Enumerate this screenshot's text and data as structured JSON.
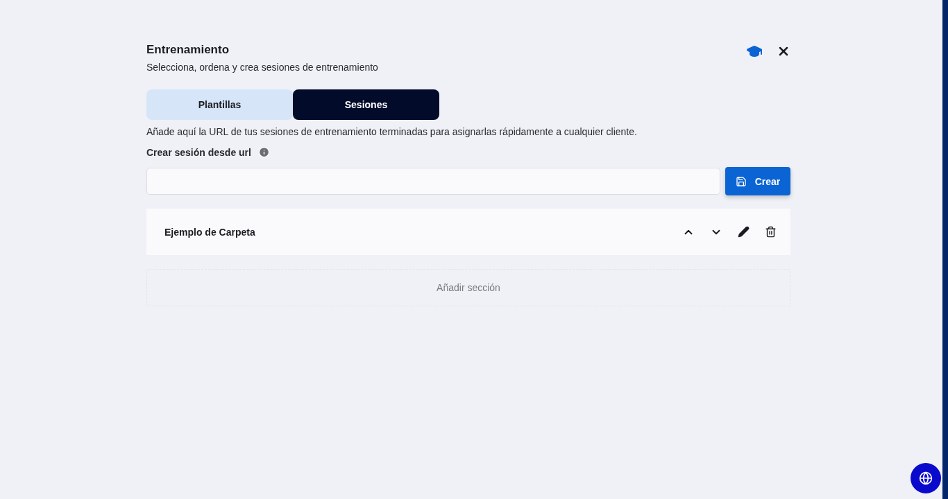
{
  "header": {
    "title": "Entrenamiento",
    "subtitle": "Selecciona, ordena y crea sesiones de entrenamiento"
  },
  "tabs": [
    {
      "label": "Plantillas",
      "selected": false
    },
    {
      "label": "Sesiones",
      "selected": true
    }
  ],
  "description": "Añade aquí la URL de tus sesiones de entrenamiento terminadas para asignarlas rápidamente a cualquier cliente.",
  "url_form": {
    "label": "Crear sesión desde url",
    "button": "Crear"
  },
  "folders": [
    {
      "name": "Ejemplo de Carpeta"
    }
  ],
  "add_section": "Añadir sección"
}
